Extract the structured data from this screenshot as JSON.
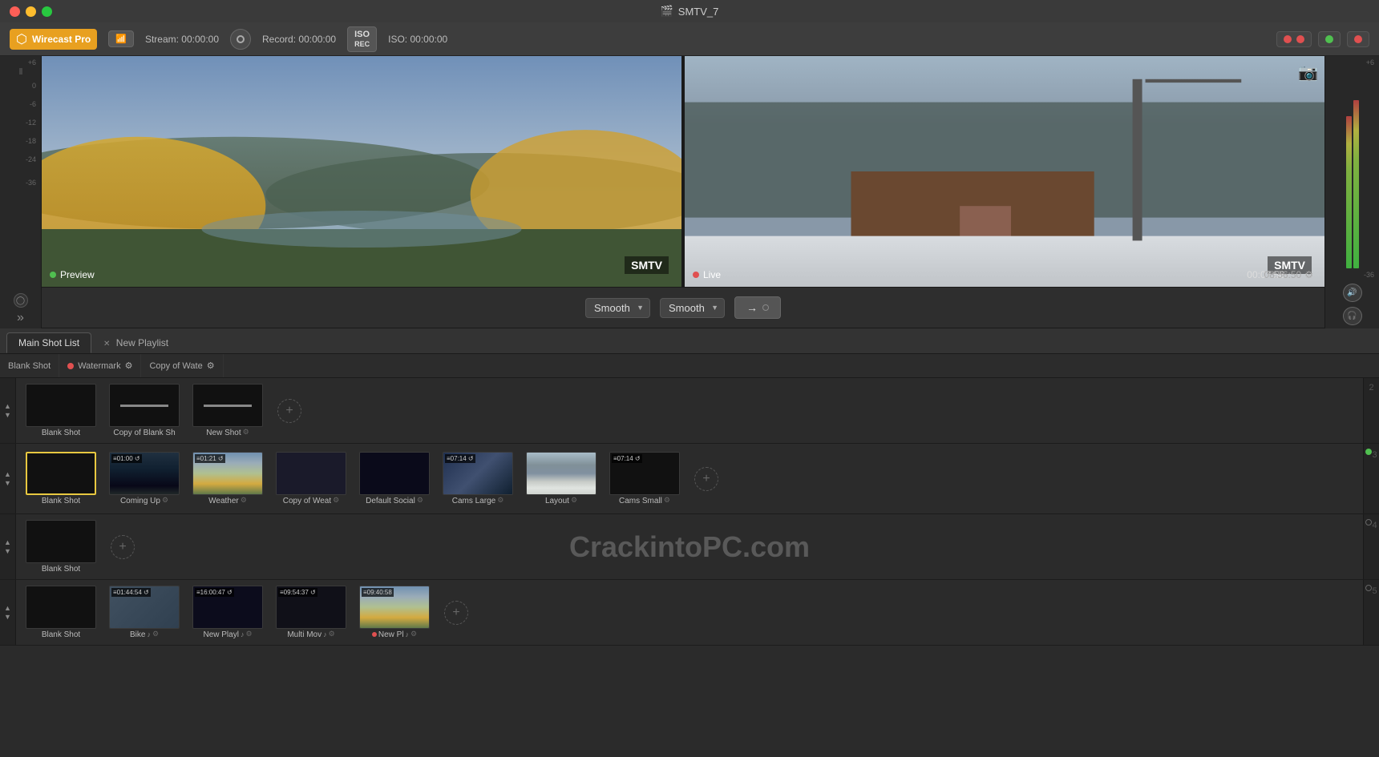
{
  "window": {
    "title": "SMTV_7",
    "file_icon": "📄"
  },
  "toolbar": {
    "logo": "Wirecast Pro",
    "wifi_label": "wifi",
    "stream_label": "Stream:",
    "stream_time": "00:00:00",
    "record_label": "Record:",
    "record_time": "00:00:00",
    "iso_label": "ISO",
    "iso_time_label": "ISO:",
    "iso_time": "00:00:00"
  },
  "preview": {
    "left_label": "Preview",
    "right_label": "Live",
    "watermark": "SMTV",
    "live_time": "00:07:56",
    "clock_time": "08:56:50"
  },
  "transition": {
    "left_smooth": "Smooth",
    "right_smooth": "Smooth",
    "go_arrow": "→"
  },
  "vu_meter": {
    "scale": [
      "+6",
      "0",
      "-6",
      "-12",
      "-18",
      "-24",
      "-36"
    ]
  },
  "tabs": {
    "main": "Main Shot List",
    "playlist": "New Playlist"
  },
  "master_row": {
    "items": [
      {
        "label": "Blank Shot",
        "dot_color": "none"
      },
      {
        "label": "Watermark",
        "dot_color": "red"
      },
      {
        "label": "Copy of Wate",
        "dot_color": "none"
      },
      {
        "label": "gear"
      }
    ]
  },
  "layers": [
    {
      "number": "2",
      "shots": [
        {
          "label": "Blank Shot",
          "type": "blank",
          "selected": false
        },
        {
          "label": "Copy of Blank Sh",
          "type": "line",
          "selected": false
        },
        {
          "label": "New Shot",
          "type": "line",
          "gear": true,
          "selected": false
        }
      ],
      "has_add": true
    },
    {
      "number": "3",
      "shots": [
        {
          "label": "Blank Shot",
          "type": "blank",
          "selected": true
        },
        {
          "label": "Coming Up",
          "type": "news",
          "duration": "01:00",
          "loop": true,
          "gear": true,
          "selected": false
        },
        {
          "label": "Weather",
          "type": "weather",
          "duration": "01:21",
          "loop": true,
          "gear": true,
          "selected": false
        },
        {
          "label": "Copy of Weat",
          "type": "weather2",
          "duration": null,
          "loop": false,
          "gear": true,
          "selected": false
        },
        {
          "label": "Default Social",
          "type": "social",
          "duration": null,
          "loop": false,
          "gear": true,
          "selected": false
        },
        {
          "label": "Cams Large",
          "type": "layout",
          "duration": "07:14",
          "loop": true,
          "gear": true,
          "selected": false
        },
        {
          "label": "Layout",
          "type": "layout2",
          "duration": null,
          "loop": false,
          "gear": true,
          "selected": false
        },
        {
          "label": "Cams Small",
          "type": "blank",
          "duration": "07:14",
          "loop": true,
          "gear": true,
          "selected": false
        }
      ],
      "has_add": true
    },
    {
      "number": "4",
      "shots": [
        {
          "label": "Blank Shot",
          "type": "blank",
          "selected": false
        }
      ],
      "has_add": true
    },
    {
      "number": "5",
      "shots": [
        {
          "label": "Blank Shot",
          "type": "blank",
          "selected": false
        },
        {
          "label": "Bike",
          "type": "bike",
          "duration": "01:44:54",
          "loop": true,
          "audio": true,
          "gear": true,
          "selected": false
        },
        {
          "label": "New Playl",
          "type": "news2",
          "duration": "16:00:47",
          "loop": true,
          "audio": true,
          "gear": true,
          "selected": false
        },
        {
          "label": "Multi Mov",
          "type": "multi",
          "duration": "09:54:37",
          "loop": true,
          "audio": true,
          "gear": true,
          "selected": false
        },
        {
          "label": "New Pl",
          "type": "playlist",
          "duration": "09:40:58",
          "loop": false,
          "audio": true,
          "dot": "red",
          "gear": true,
          "selected": false
        }
      ],
      "has_add": true
    }
  ],
  "icons": {
    "gear": "⚙",
    "close": "✕",
    "add": "+",
    "arrow_up": "▲",
    "arrow_down": "▼",
    "loop": "↺",
    "audio": "♪"
  }
}
